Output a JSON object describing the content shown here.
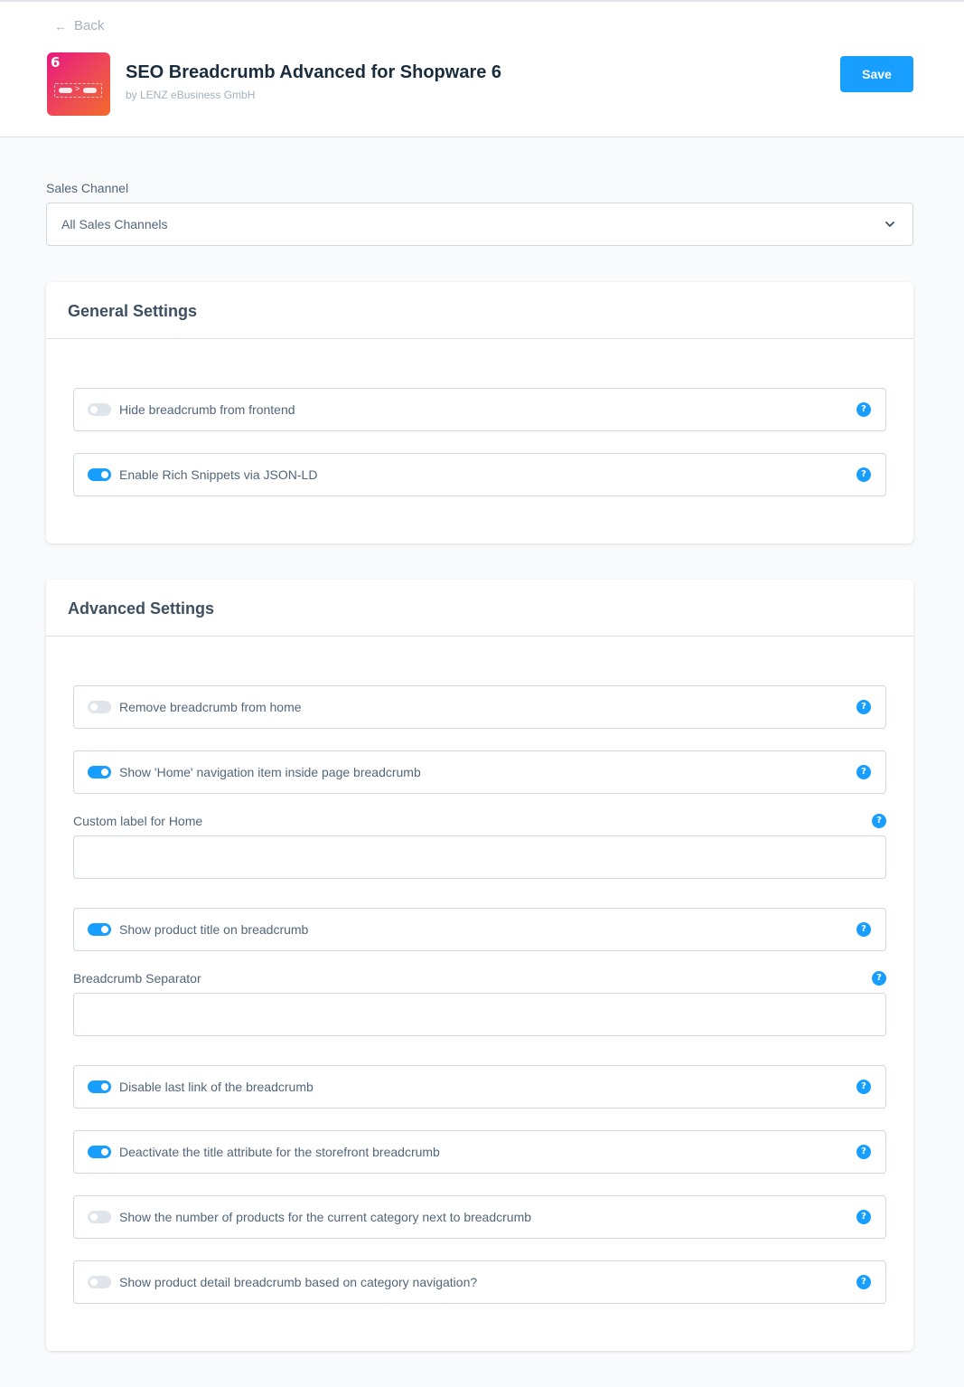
{
  "header": {
    "back_label": "Back",
    "icon_number": "6",
    "icon_separator": ">",
    "title": "SEO Breadcrumb Advanced for Shopware 6",
    "subtitle": "by LENZ eBusiness GmbH",
    "save_label": "Save"
  },
  "sales_channel": {
    "label": "Sales Channel",
    "value": "All Sales Channels"
  },
  "general": {
    "title": "General Settings",
    "items": [
      {
        "label": "Hide breadcrumb from frontend",
        "on": false
      },
      {
        "label": "Enable Rich Snippets via JSON-LD",
        "on": true
      }
    ]
  },
  "advanced": {
    "title": "Advanced Settings",
    "remove_home": {
      "label": "Remove breadcrumb from home",
      "on": false
    },
    "show_home": {
      "label": "Show 'Home' navigation item inside page breadcrumb",
      "on": true
    },
    "custom_home_label": {
      "label": "Custom label for Home",
      "value": ""
    },
    "show_product_title": {
      "label": "Show product title on breadcrumb",
      "on": true
    },
    "separator": {
      "label": "Breadcrumb Separator",
      "value": ""
    },
    "disable_last_link": {
      "label": "Disable last link of the breadcrumb",
      "on": true
    },
    "deactivate_title_attr": {
      "label": "Deactivate the title attribute for the storefront breadcrumb",
      "on": true
    },
    "show_product_count": {
      "label": "Show the number of products for the current category next to breadcrumb",
      "on": false
    },
    "category_based": {
      "label": "Show product detail breadcrumb based on category navigation?",
      "on": false
    }
  },
  "help_glyph": "?",
  "colors": {
    "primary": "#189eff",
    "toggle_off": "#dfe5ea",
    "text": "#52667a",
    "title": "#1a2d3e"
  }
}
